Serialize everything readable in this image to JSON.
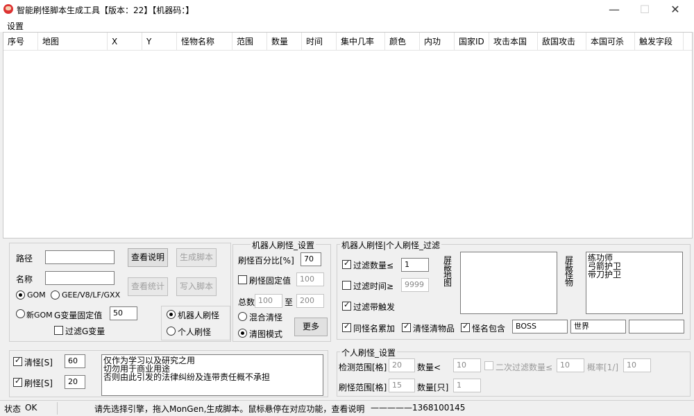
{
  "window": {
    "title": "智能刷怪脚本生成工具【版本：22】【机器码：】",
    "minimize": "—",
    "maximize": "☐",
    "close": "✕"
  },
  "menu": {
    "settings": "设置"
  },
  "table": {
    "columns": [
      "序号",
      "地图",
      "X",
      "Y",
      "怪物名称",
      "范围",
      "数量",
      "时间",
      "集中几率",
      "颜色",
      "内功",
      "国家ID",
      "攻击本国",
      "敌国攻击",
      "本国可杀",
      "触发字段"
    ]
  },
  "left": {
    "path_label": "路径",
    "name_label": "名称",
    "view_help": "查看说明",
    "generate_script": "生成脚本",
    "view_stats": "查看统计",
    "write_script": "写入脚本",
    "radio_gom": "GOM",
    "radio_gee": "GEE/V8/LF/GXX",
    "radio_newgom": "新GOM",
    "g_fixed_label": "G变量固定值",
    "g_fixed_value": "50",
    "filter_g": "过滤G变量",
    "robot_mode": "机器人刷怪",
    "personal_mode": "个人刷怪"
  },
  "robot": {
    "title": "机器人刷怪_设置",
    "percent_label": "刷怪百分比[%]",
    "percent_value": "70",
    "fixed_label": "刷怪固定值",
    "fixed_value": "100",
    "total_label": "总数",
    "total_from": "100",
    "to_label": "至",
    "total_to": "200",
    "mixed_clear": "混合清怪",
    "clear_mode": "清图模式",
    "more": "更多"
  },
  "filter": {
    "title": "机器人刷怪|个人刷怪_过滤",
    "filter_count": "过滤数量≤",
    "filter_count_value": "1",
    "filter_time": "过滤时间≥",
    "filter_time_value": "9999",
    "filter_trigger": "过滤带触发",
    "block_map": "屏蔽地图",
    "block_monster": "屏蔽怪物",
    "monster_list": [
      "练功师",
      "弓箭护卫",
      "带刀护卫"
    ],
    "same_name": "同怪名累加",
    "clear_items": "清怪清物品",
    "name_contains": "怪名包含",
    "kw1": "BOSS",
    "kw2": "世界",
    "kw3": ""
  },
  "bottom_left": {
    "clear_label": "清怪[S]",
    "clear_value": "60",
    "spawn_label": "刷怪[S]",
    "spawn_value": "20",
    "notice": [
      "仅作为学习以及研究之用",
      "切勿用于商业用途",
      "否则由此引发的法律纠纷及连带责任概不承担"
    ]
  },
  "personal": {
    "title": "个人刷怪_设置",
    "detect_range": "检测范围[格]",
    "detect_value": "20",
    "count_lt": "数量<",
    "count_lt_value": "10",
    "second_filter": "二次过滤数量≤",
    "second_value": "10",
    "prob_label": "概率[1/]",
    "prob_value": "10",
    "spawn_range": "刷怪范围[格]",
    "spawn_range_value": "15",
    "count_only": "数量[只]",
    "count_only_value": "1"
  },
  "status": {
    "label": "状态",
    "value": "OK",
    "message": "请先选择引擎，拖入MonGen,生成脚本。鼠标悬停在对应功能，查看说明",
    "contact": "—————1368100145"
  }
}
